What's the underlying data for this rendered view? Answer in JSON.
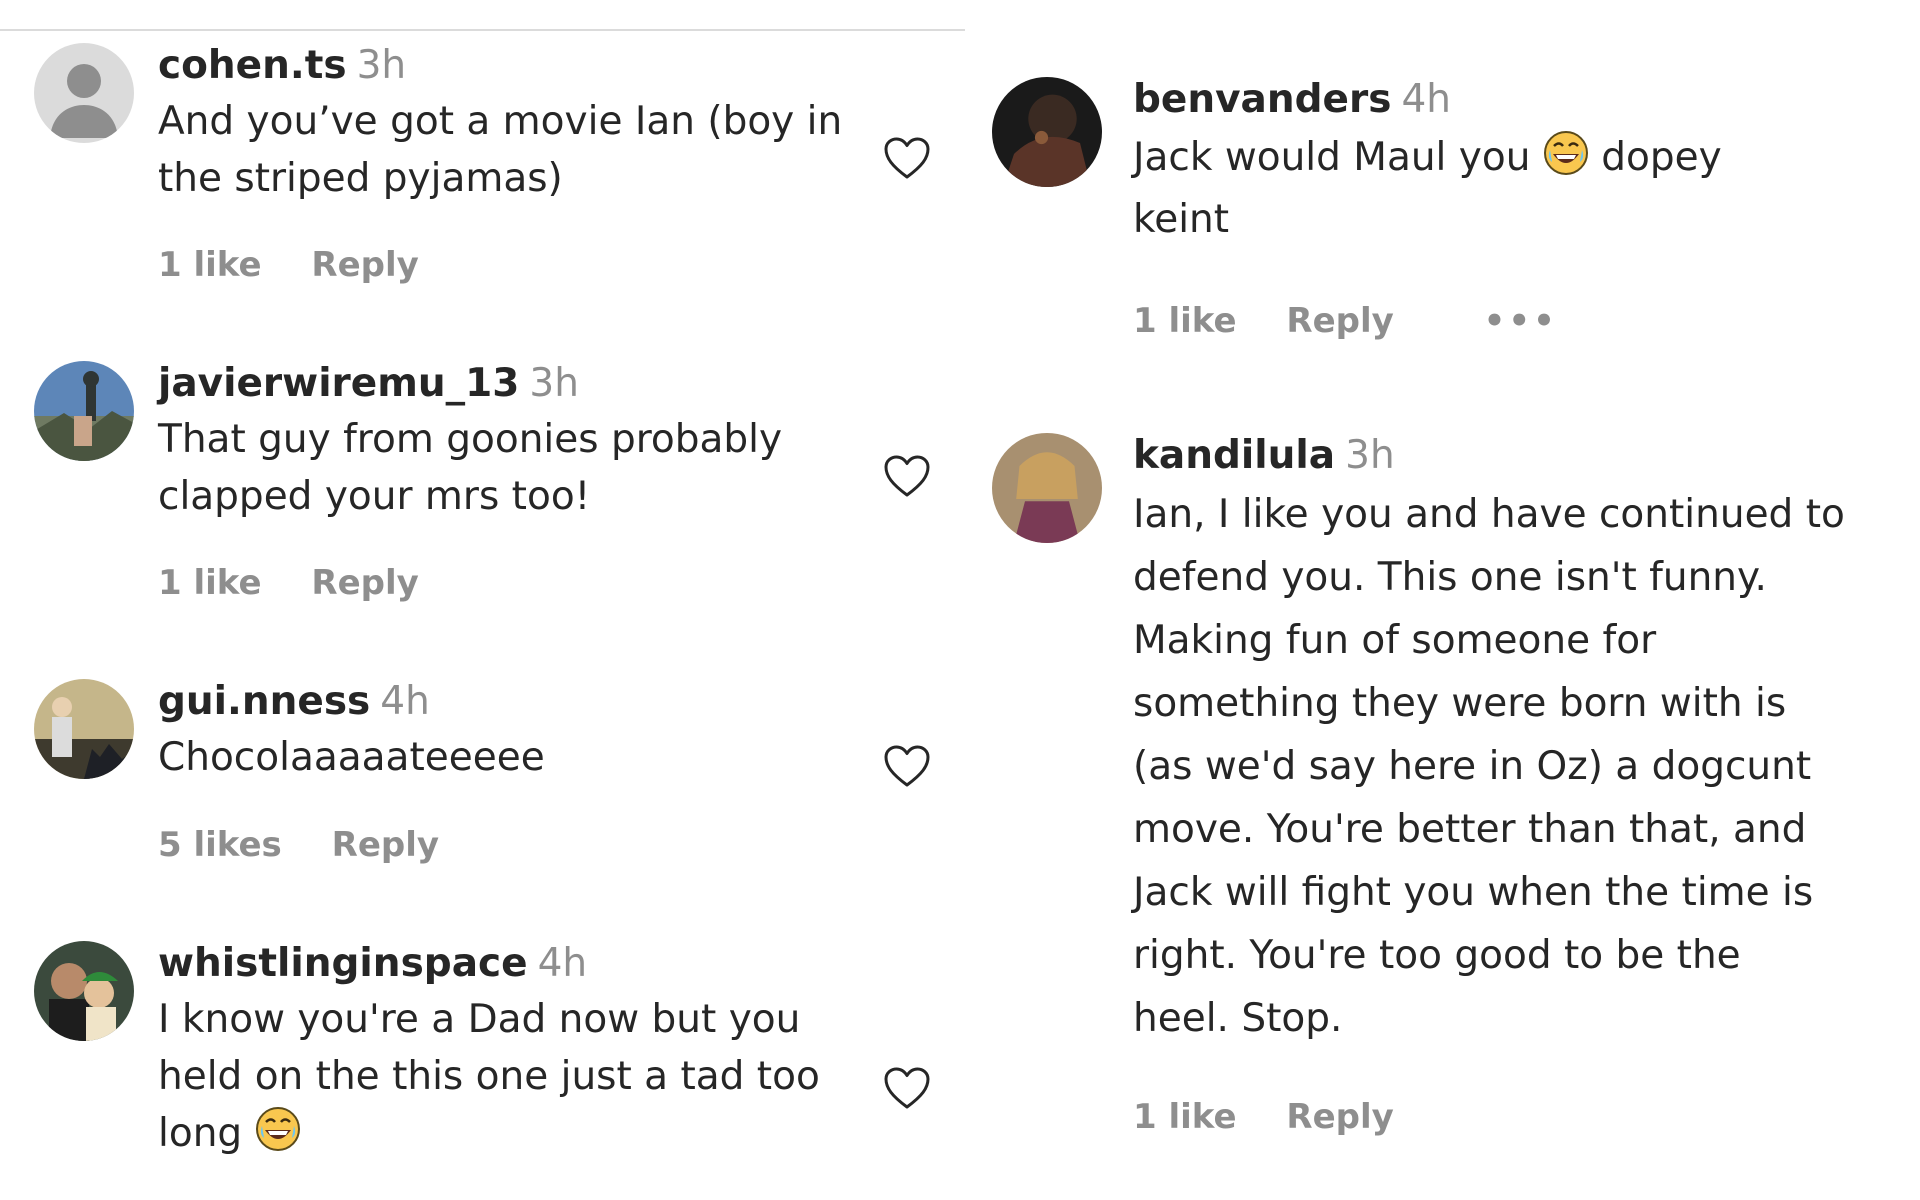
{
  "comments_left": [
    {
      "username": "cohen.ts",
      "time": "3h",
      "text_lines": [
        "And you’ve got a movie Ian (boy in",
        "the striped pyjamas)"
      ],
      "likes": "1 like",
      "reply": "Reply",
      "avatar": "default-avatar"
    },
    {
      "username": "javierwiremu_13",
      "time": "3h",
      "text_lines": [
        "That guy from goonies probably",
        "clapped your mrs too!"
      ],
      "likes": "1 like",
      "reply": "Reply",
      "avatar": "photo-avatar"
    },
    {
      "username": "gui.nness",
      "time": "4h",
      "text_lines": [
        "Chocolaaaaateeeee"
      ],
      "likes": "5 likes",
      "reply": "Reply",
      "avatar": "photo-avatar"
    },
    {
      "username": "whistlinginspace",
      "time": "4h",
      "text_lines": [
        "I know you're a Dad now but you",
        "held on the this one just a tad too",
        "long"
      ],
      "emoji_after_last_line": "laughing-emoji",
      "avatar": "photo-avatar"
    }
  ],
  "comments_right": [
    {
      "username": "benvanders",
      "time": "4h",
      "text_lines": [
        "Jack would Maul you",
        "keint"
      ],
      "line1_suffix": "dopey",
      "emoji_in_line1": "laughing-emoji",
      "likes": "1 like",
      "reply": "Reply",
      "more": "•••",
      "avatar": "photo-avatar"
    },
    {
      "username": "kandilula",
      "time": "3h",
      "text_lines": [
        "Ian, I like you and have continued to",
        "defend you. This one isn't funny.",
        "Making fun of someone for",
        "something they were born with is",
        "(as we'd say here in Oz) a dogcunt",
        "move. You're better than that, and",
        "Jack will fight you when the time is",
        "right. You're too good to be the",
        "heel. Stop."
      ],
      "likes": "1 like",
      "reply": "Reply",
      "avatar": "photo-avatar"
    }
  ],
  "icons": {
    "like": "heart-outline-icon",
    "more": "more-options-icon"
  },
  "colors": {
    "text": "#262626",
    "secondary": "#8e8e8e",
    "divider": "#dbdbdb"
  }
}
